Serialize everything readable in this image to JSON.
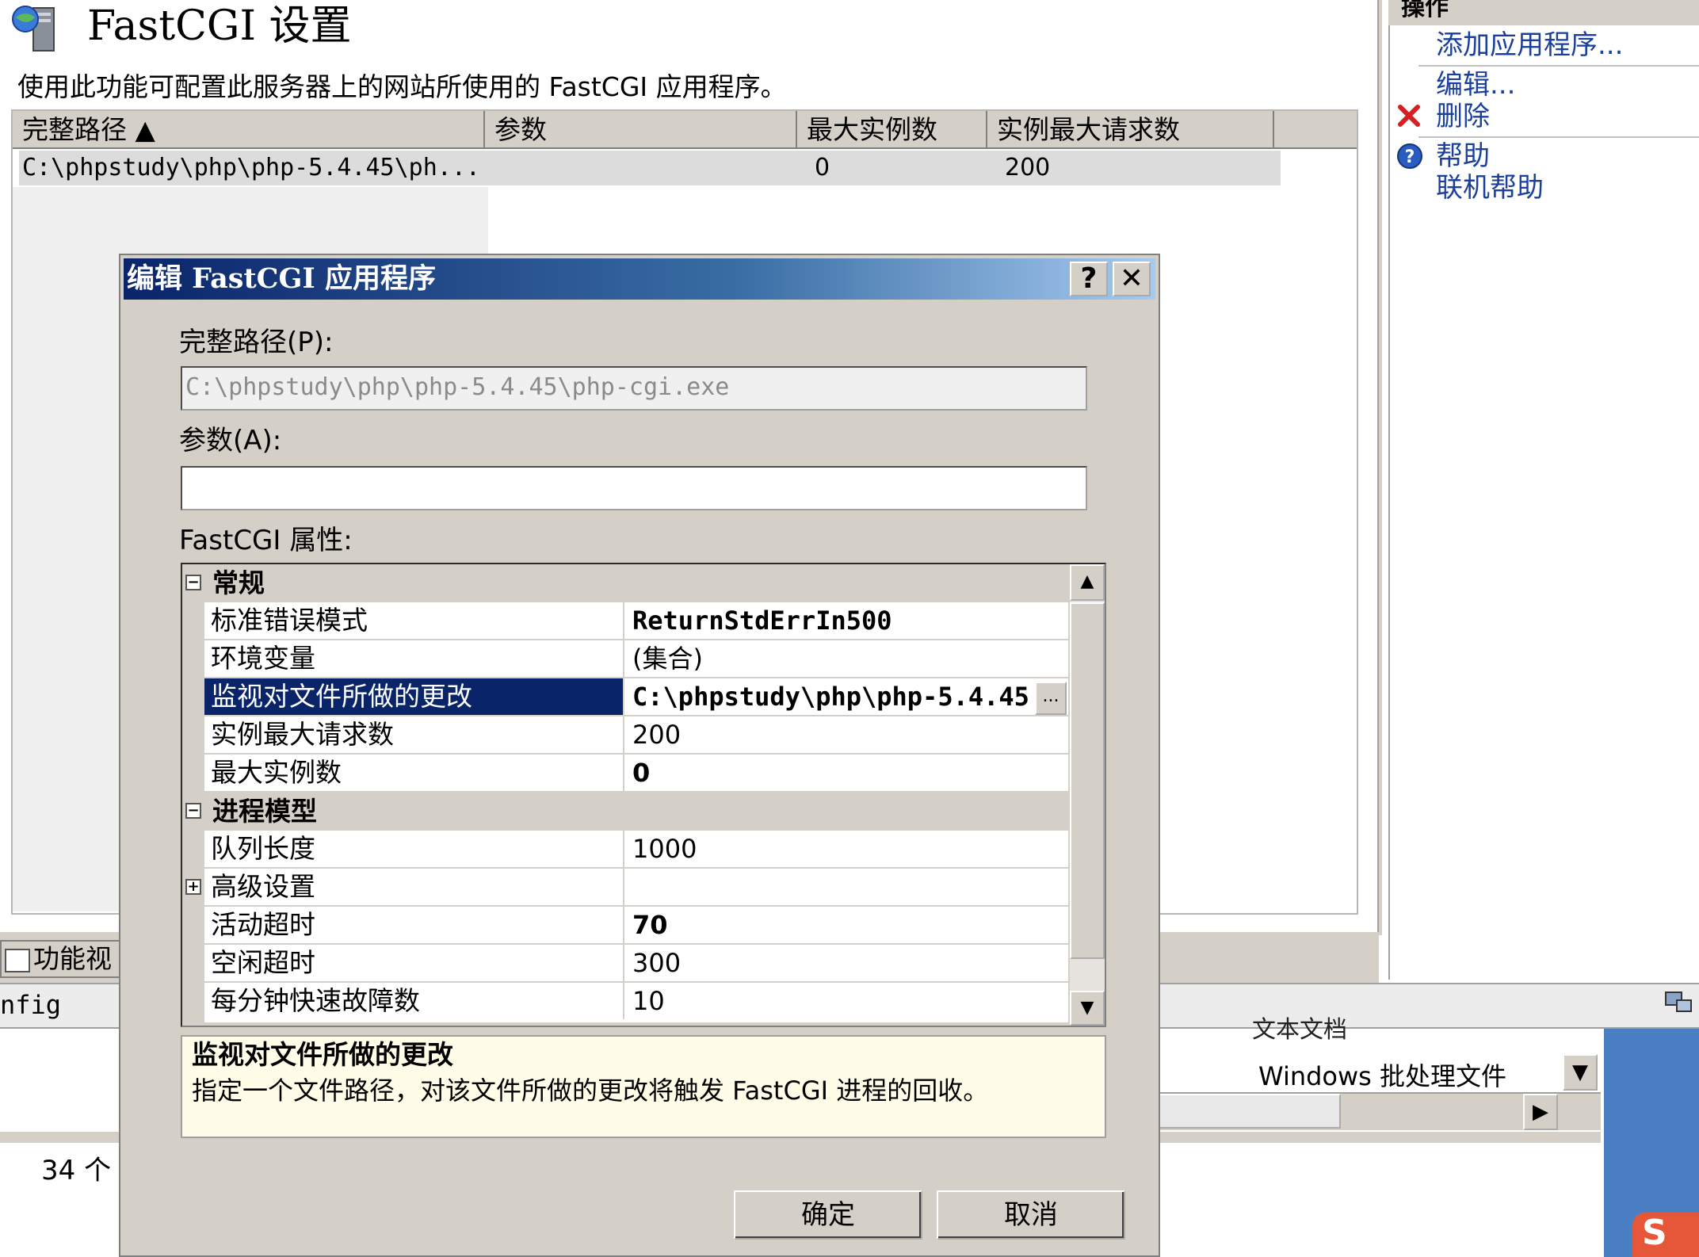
{
  "page": {
    "title": "FastCGI 设置",
    "description": "使用此功能可配置此服务器上的网站所使用的 FastCGI 应用程序。",
    "icon": "server-globe-icon"
  },
  "list": {
    "columns": [
      "完整路径 ▲",
      "参数",
      "最大实例数",
      "实例最大请求数"
    ],
    "rows": [
      {
        "path": "C:\\phpstudy\\php\\php-5.4.45\\ph...",
        "args": "",
        "max_instances": "0",
        "max_requests": "200"
      }
    ]
  },
  "actions": {
    "header": "操作",
    "items": [
      "添加应用程序...",
      "编辑...",
      "删除",
      "帮助",
      "联机帮助"
    ],
    "icons": {
      "delete": "red-x-icon",
      "help": "help-circle-icon"
    }
  },
  "bottom": {
    "tab_label": "功能视",
    "config_label": "nfig",
    "file_type_cut": "文本文档",
    "file_type": "Windows 批处理文件",
    "count_text": "34 个"
  },
  "dialog": {
    "title": "编辑 FastCGI 应用程序",
    "help_button": "?",
    "close_button": "✕",
    "path_label": "完整路径(P):",
    "path_value": "C:\\phpstudy\\php\\php-5.4.45\\php-cgi.exe",
    "args_label": "参数(A):",
    "args_value": "",
    "props_label": "FastCGI 属性:",
    "categories": [
      {
        "name": "常规",
        "toggle": "⊟"
      },
      {
        "name": "进程模型",
        "toggle": "⊟"
      }
    ],
    "props": [
      {
        "name": "标准错误模式",
        "value": "ReturnStdErrIn500"
      },
      {
        "name": "环境变量",
        "value": "(集合)"
      },
      {
        "name": "监视对文件所做的更改",
        "value": "C:\\phpstudy\\php\\php-5.4.45"
      },
      {
        "name": "实例最大请求数",
        "value": "200"
      },
      {
        "name": "最大实例数",
        "value": "0"
      },
      {
        "name": "队列长度",
        "value": "1000"
      },
      {
        "name": "高级设置",
        "value": "",
        "toggle": "⊞"
      },
      {
        "name": "活动超时",
        "value": "70"
      },
      {
        "name": "空闲超时",
        "value": "300"
      },
      {
        "name": "每分钟快速故障数",
        "value": "10"
      }
    ],
    "ellipsis": "...",
    "desc_title": "监视对文件所做的更改",
    "desc_text": "指定一个文件路径，对该文件所做的更改将触发 FastCGI 进程的回收。",
    "ok": "确定",
    "cancel": "取消",
    "scroll_up": "▲",
    "scroll_down": "▼"
  },
  "colors": {
    "selection": "#0a246a",
    "link": "#1a3f9c",
    "dialog_face": "#d4d0c8"
  }
}
